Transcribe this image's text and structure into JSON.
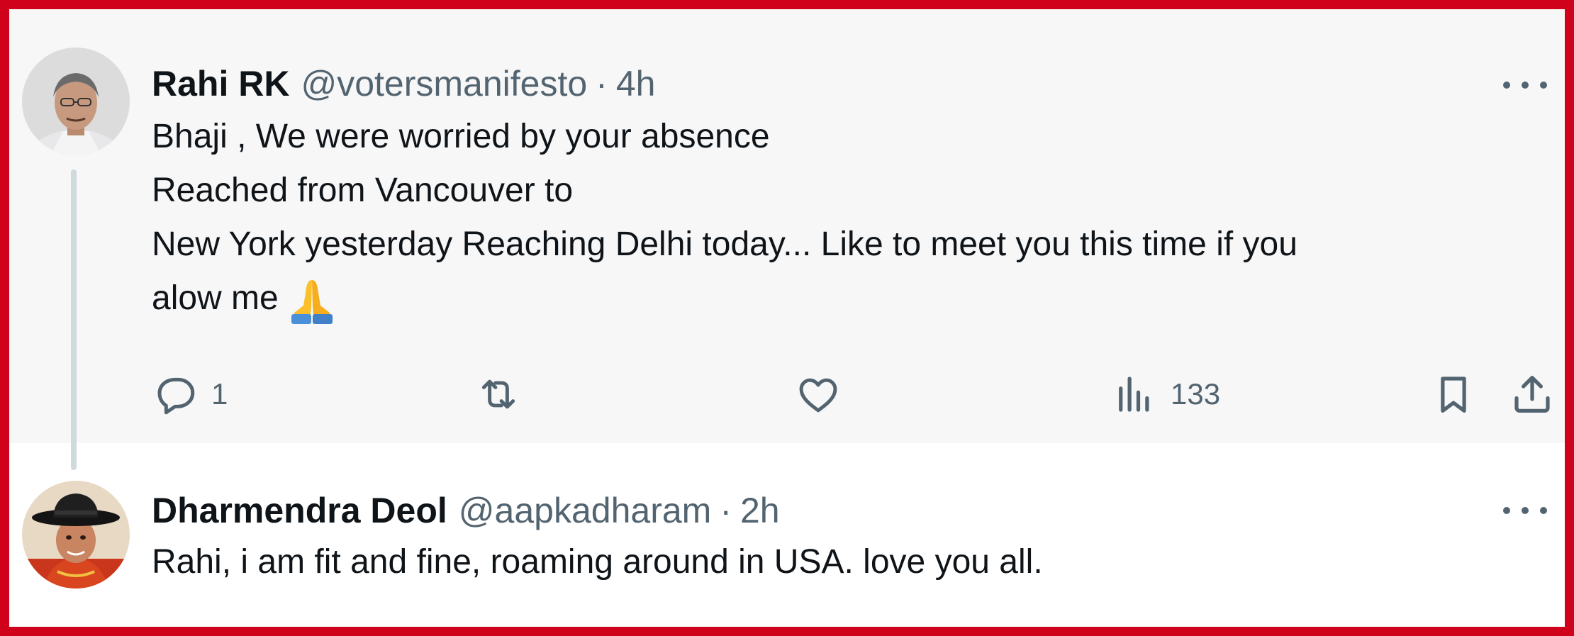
{
  "tweets": [
    {
      "author_name": "Rahi RK",
      "handle": "@votersmanifesto",
      "separator": "·",
      "time": "4h",
      "text_lines": [
        "Bhaji , We were worried by your absence",
        "Reached from Vancouver to",
        "New York yesterday Reaching Delhi today... Like to meet you this time if you",
        "alow me"
      ],
      "emoji": "folded-hands",
      "actions": {
        "reply_count": "1",
        "retweet_count": "",
        "like_count": "",
        "views_count": "133"
      }
    },
    {
      "author_name": "Dharmendra Deol",
      "handle": "@aapkadharam",
      "separator": "·",
      "time": "2h",
      "text_lines": [
        "Rahi, i am fit and fine, roaming around in USA. love you all."
      ]
    }
  ],
  "colors": {
    "frame_border": "#d0021b",
    "reply_background": "#f7f7f8",
    "secondary_text": "#536471",
    "primary_text": "#0f1419",
    "thread_line": "#cfd9de"
  }
}
